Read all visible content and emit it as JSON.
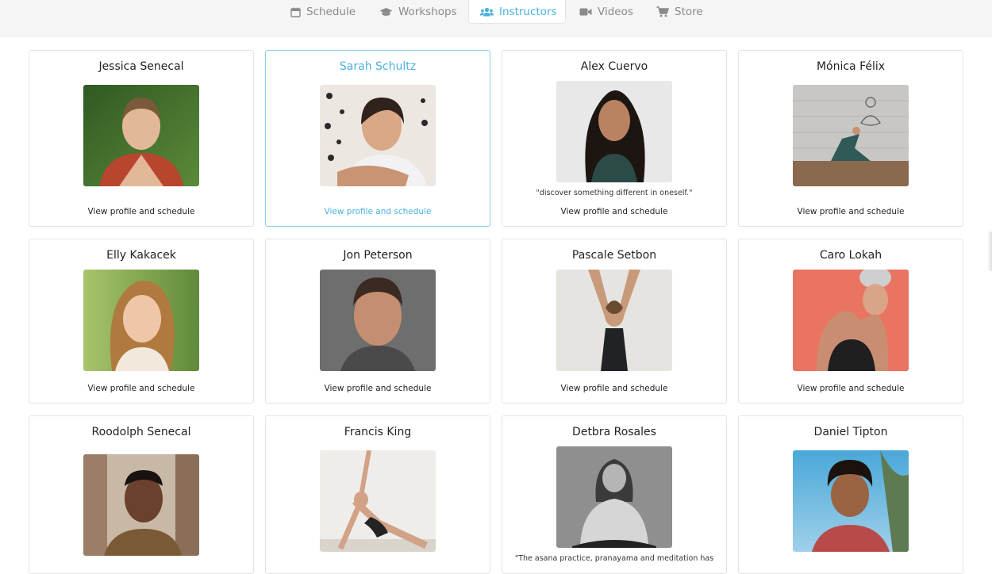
{
  "nav": {
    "tabs": [
      {
        "label": "Schedule",
        "icon": "calendar-icon"
      },
      {
        "label": "Workshops",
        "icon": "graduation-cap-icon"
      },
      {
        "label": "Instructors",
        "icon": "users-icon"
      },
      {
        "label": "Videos",
        "icon": "video-camera-icon"
      },
      {
        "label": "Store",
        "icon": "shopping-cart-icon"
      }
    ],
    "active_tab": "Instructors",
    "colors": {
      "active": "#4ab0e0",
      "inactive": "#8a8a8a",
      "bar": "#f5f5f5"
    }
  },
  "instructors": [
    {
      "name": "Jessica Senecal",
      "link": "View profile and schedule"
    },
    {
      "name": "Sarah Schultz",
      "link": "View profile and schedule"
    },
    {
      "name": "Alex Cuervo",
      "quote": "\"discover something different in oneself.\"",
      "link": "View profile and schedule"
    },
    {
      "name": "Mónica Félix",
      "link": "View profile and schedule"
    },
    {
      "name": "Elly Kakacek",
      "link": "View profile and schedule"
    },
    {
      "name": "Jon Peterson",
      "link": "View profile and schedule"
    },
    {
      "name": "Pascale Setbon",
      "link": "View profile and schedule"
    },
    {
      "name": "Caro Lokah",
      "link": "View profile and schedule"
    },
    {
      "name": "Roodolph Senecal"
    },
    {
      "name": "Francis King"
    },
    {
      "name": "Detbra Rosales",
      "quote": "\"The asana practice, pranayama and meditation has"
    },
    {
      "name": "Daniel Tipton"
    }
  ]
}
